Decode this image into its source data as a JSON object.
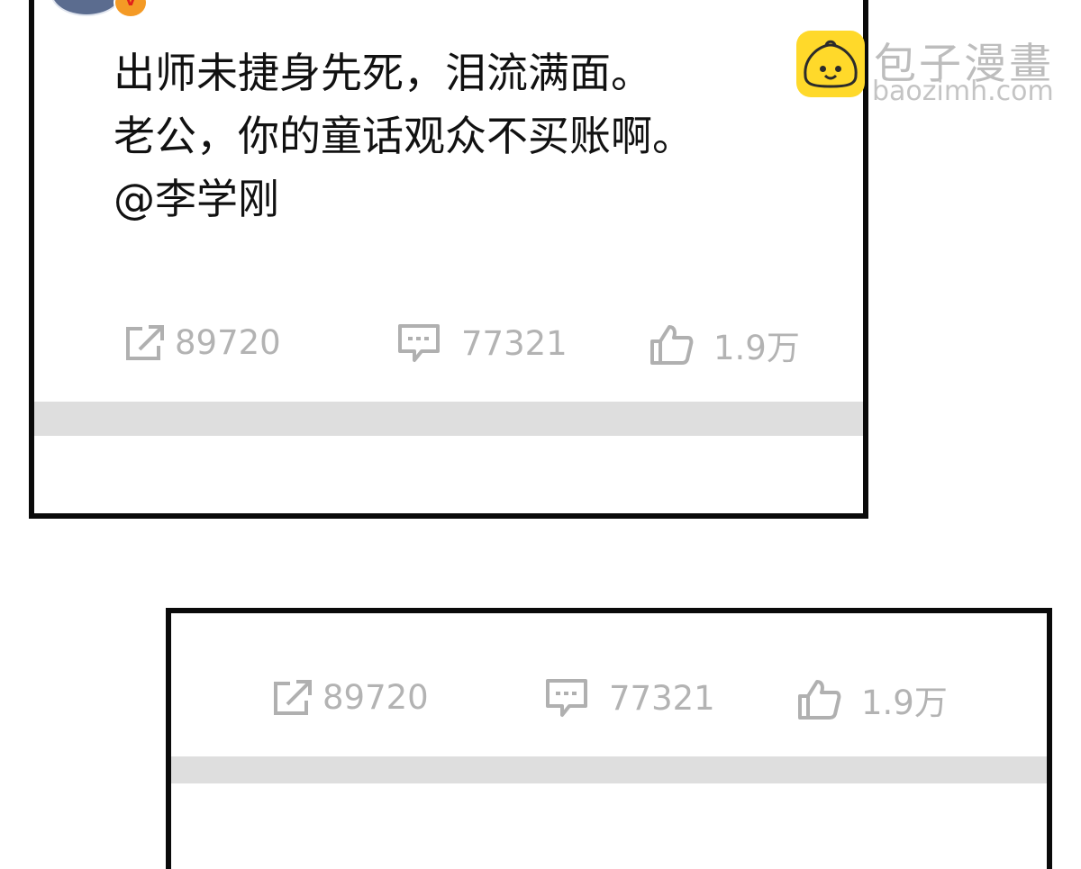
{
  "post": {
    "lines": [
      "出师未捷身先死，泪流满面。",
      "老公，你的童话观众不买账啊。",
      "@李学刚"
    ],
    "repost_count": "89720",
    "comment_count": "77321",
    "like_count": "1.9万"
  },
  "post_footer": {
    "repost_count": "89720",
    "comment_count": "77321",
    "like_count": "1.9万"
  },
  "watermark": {
    "title": "包子漫畫",
    "url": "baozimh.com"
  },
  "icons": {
    "repost": "share-icon",
    "comment": "comment-icon",
    "like": "thumbs-up-icon",
    "verified": "verified-badge-icon",
    "logo": "baozi-logo-icon"
  },
  "colors": {
    "border": "#0a0a0a",
    "stat_text": "#b3b3b3",
    "band": "#dedede",
    "logo": "#ffd92a",
    "badge": "#f49a25"
  }
}
